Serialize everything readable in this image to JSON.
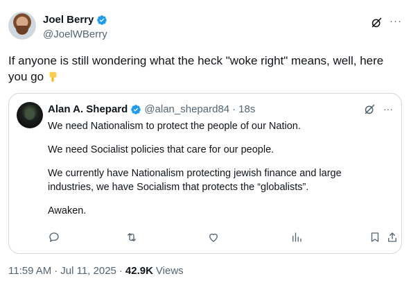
{
  "author": {
    "name": "Joel Berry",
    "handle": "@JoelWBerry"
  },
  "tweet": {
    "text": "If anyone is still wondering what the heck \"woke right\" means, well, here you go",
    "emoji": "pointing-down-hand"
  },
  "quote": {
    "name": "Alan A. Shepard",
    "handle": "@alan_shepard84",
    "separator": "·",
    "time": "18s",
    "paragraphs": [
      "We need Nationalism to protect the people of our Nation.",
      "We need Socialist policies that care for our people.",
      "We currently have Nationalism protecting jewish finance and large industries, we have Socialism that protects the “globalists”.",
      "Awaken."
    ]
  },
  "footer": {
    "time": "11:59 AM",
    "separator": "·",
    "date": "Jul 11, 2025",
    "separator2": "·",
    "views_count": "42.9K",
    "views_label": "Views"
  },
  "icons": {
    "verified": "verified-badge-icon",
    "grok": "grok-icon",
    "more": "more-icon",
    "reply": "reply-icon",
    "repost": "repost-icon",
    "like": "like-icon",
    "views": "views-icon",
    "bookmark": "bookmark-icon",
    "share": "share-icon"
  },
  "colors": {
    "verified": "#1d9bf0",
    "text": "#0f1419",
    "secondary": "#536471",
    "border": "#cfd9de"
  }
}
